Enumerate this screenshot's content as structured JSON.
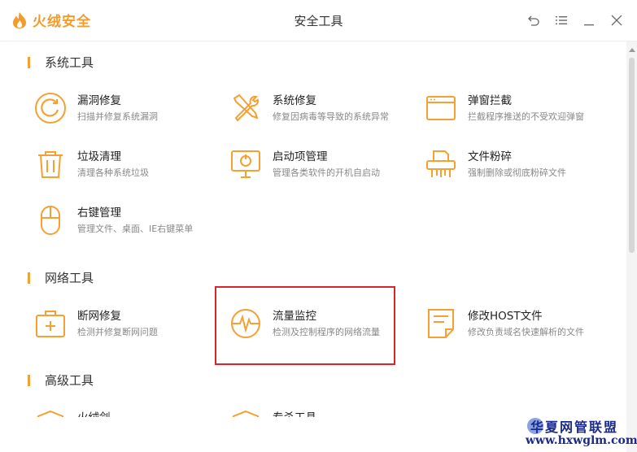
{
  "app": {
    "brand": "火绒安全",
    "window_title": "安全工具"
  },
  "colors": {
    "accent": "#f5a033",
    "highlight": "#d9232f"
  },
  "window_controls": [
    {
      "icon": "back-icon"
    },
    {
      "icon": "menu-icon"
    },
    {
      "icon": "minimize-icon"
    },
    {
      "icon": "close-icon"
    }
  ],
  "sections": {
    "system": {
      "title": "系统工具",
      "tools": [
        {
          "name": "漏洞修复",
          "desc": "扫描并修复系统漏洞",
          "icon": "vulnerability-repair-icon"
        },
        {
          "name": "系统修复",
          "desc": "修复因病毒等导致的系统异常",
          "icon": "system-repair-icon"
        },
        {
          "name": "弹窗拦截",
          "desc": "拦截程序推送的不受欢迎弹窗",
          "icon": "popup-block-icon"
        },
        {
          "name": "垃圾清理",
          "desc": "清理各种系统垃圾",
          "icon": "trash-icon"
        },
        {
          "name": "启动项管理",
          "desc": "管理各类软件的开机自启动",
          "icon": "startup-monitor-icon"
        },
        {
          "name": "文件粉碎",
          "desc": "强制删除或彻底粉碎文件",
          "icon": "shredder-icon"
        },
        {
          "name": "右键管理",
          "desc": "管理文件、桌面、IE右键菜单",
          "icon": "mouse-icon"
        }
      ]
    },
    "network": {
      "title": "网络工具",
      "tools": [
        {
          "name": "断网修复",
          "desc": "检测并修复断网问题",
          "icon": "first-aid-icon"
        },
        {
          "name": "流量监控",
          "desc": "检测及控制程序的网络流量",
          "icon": "traffic-monitor-icon"
        },
        {
          "name": "修改HOST文件",
          "desc": "修改负责域名快速解析的文件",
          "icon": "host-file-icon"
        }
      ]
    },
    "advanced": {
      "title": "高级工具",
      "tools": [
        {
          "name": "火绒剑",
          "icon": "shield-icon"
        },
        {
          "name": "专杀工具",
          "icon": "shield-icon"
        }
      ]
    }
  },
  "watermark": {
    "line1": "华夏网管联盟",
    "line2": "www.hxwglm.com"
  }
}
